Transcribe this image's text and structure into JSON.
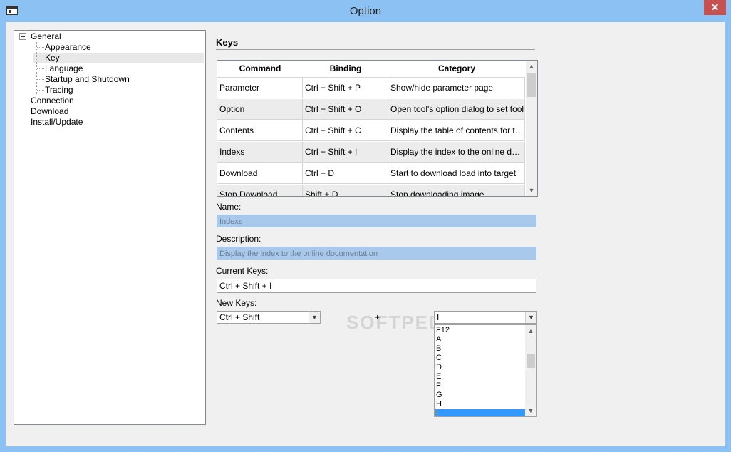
{
  "window": {
    "title": "Option",
    "close_glyph": "✕",
    "app_icon": "app-window-icon"
  },
  "tree": {
    "items": [
      {
        "label": "General",
        "level": 0,
        "expanded": true
      },
      {
        "label": "Appearance",
        "level": 1
      },
      {
        "label": "Key",
        "level": 1,
        "selected": true
      },
      {
        "label": "Language",
        "level": 1
      },
      {
        "label": "Startup and Shutdown",
        "level": 1
      },
      {
        "label": "Tracing",
        "level": 1
      },
      {
        "label": "Connection",
        "level": 0
      },
      {
        "label": "Download",
        "level": 0
      },
      {
        "label": "Install/Update",
        "level": 0
      }
    ]
  },
  "keys": {
    "title": "Keys",
    "columns": [
      "Command",
      "Binding",
      "Category"
    ],
    "rows": [
      [
        "Parameter",
        "Ctrl + Shift + P",
        "Show/hide parameter page"
      ],
      [
        "Option",
        "Ctrl + Shift + O",
        "Open tool's option dialog to set tool"
      ],
      [
        "Contents",
        "Ctrl + Shift + C",
        "Display the table of contents for the"
      ],
      [
        "Indexs",
        "Ctrl + Shift + I",
        "Display the index to the online documentation"
      ],
      [
        "Download",
        "Ctrl + D",
        "Start to download load into target"
      ],
      [
        "Stop Download",
        "Shift + D",
        "Stop downloading image"
      ]
    ]
  },
  "form": {
    "name_label": "Name:",
    "name_value": "Indexs",
    "description_label": "Description:",
    "description_value": "Display the index to the online documentation",
    "current_keys_label": "Current Keys:",
    "current_keys_value": "Ctrl + Shift + I",
    "new_keys_label": "New Keys:",
    "modifier_value": "Ctrl + Shift",
    "plus": "+",
    "key_value": "I",
    "key_options": [
      "F12",
      "A",
      "B",
      "C",
      "D",
      "E",
      "F",
      "G",
      "H",
      "I"
    ],
    "key_selected": "I"
  },
  "watermark": "SOFTPEDIA",
  "colors": {
    "titlebar": "#8cc2f3",
    "close": "#c75050",
    "selection": "#3399ff",
    "disabled_field": "#a8c8ec"
  }
}
